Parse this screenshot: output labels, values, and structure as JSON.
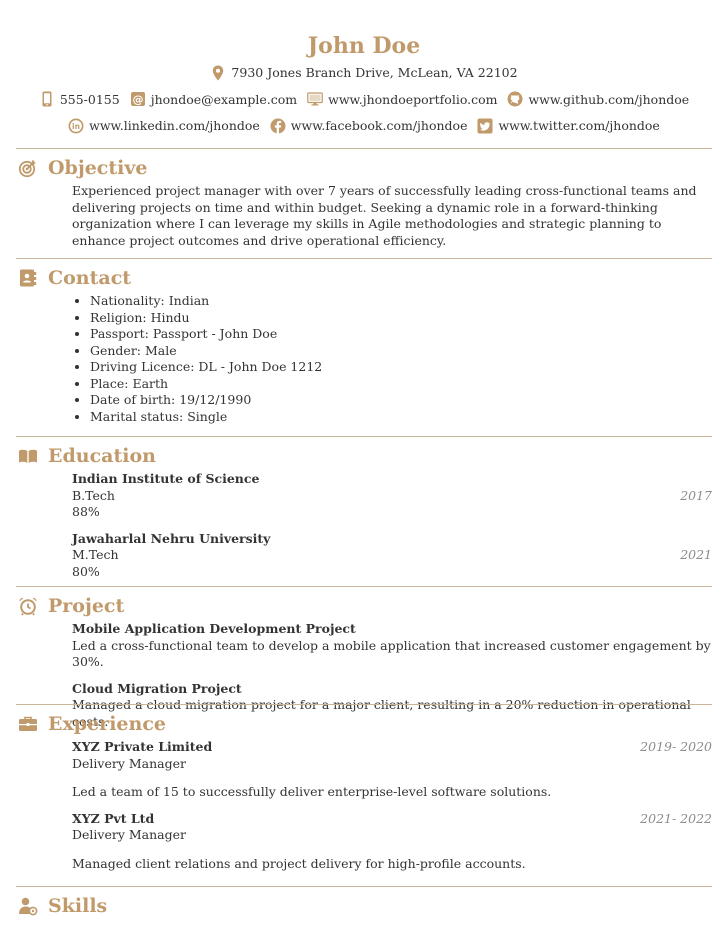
{
  "header": {
    "name": "John Doe",
    "address": "7930 Jones Branch Drive, McLean, VA 22102",
    "phone": "555-0155",
    "email": "jhondoe@example.com",
    "portfolio": "www.jhondoeportfolio.com",
    "github": "www.github.com/jhondoe",
    "linkedin": "www.linkedin.com/jhondoe",
    "facebook": "www.facebook.com/jhondoe",
    "twitter": "www.twitter.com/jhondoe"
  },
  "colors": {
    "accent": "#c19a6b",
    "rule": "#c8b59a",
    "text": "#333333",
    "date": "#8c8c8c"
  },
  "objective": {
    "title": "Objective",
    "icon": "target-icon",
    "text": "Experienced project manager with over 7 years of successfully leading cross-functional teams and delivering projects on time and within budget. Seeking a dynamic role in a forward-thinking organization where I can leverage my skills in Agile methodologies and strategic planning to enhance project outcomes and drive operational efficiency."
  },
  "contact": {
    "title": "Contact",
    "icon": "address-book-icon",
    "items": [
      "Nationality: Indian",
      "Religion: Hindu",
      "Passport: Passport - John Doe",
      "Gender: Male",
      "Driving Licence: DL - John Doe 1212",
      "Place: Earth",
      "Date of birth: 19/12/1990",
      "Marital status: Single"
    ]
  },
  "education": {
    "title": "Education",
    "icon": "book-icon",
    "entries": [
      {
        "school": "Indian Institute of Science",
        "degree": "B.Tech",
        "year": "2017",
        "score": "88%"
      },
      {
        "school": "Jawaharlal Nehru University",
        "degree": "M.Tech",
        "year": "2021",
        "score": "80%"
      }
    ]
  },
  "project": {
    "title": "Project",
    "icon": "alarm-clock-icon",
    "entries": [
      {
        "name": "Mobile Application Development Project",
        "desc": "Led a cross-functional team to develop a mobile application that increased customer engagement by 30%."
      },
      {
        "name": "Cloud Migration Project",
        "desc": "Managed a cloud migration project for a major client, resulting in a 20% reduction in operational costs."
      }
    ]
  },
  "experience": {
    "title": "Experience",
    "icon": "briefcase-icon",
    "entries": [
      {
        "company": "XYZ Private Limited",
        "role": "Delivery Manager",
        "dates": "2019- 2020",
        "desc": "Led a team of 15 to successfully deliver enterprise-level software solutions."
      },
      {
        "company": "XYZ Pvt Ltd",
        "role": "Delivery Manager",
        "dates": "2021- 2022",
        "desc": "Managed client relations and project delivery for high-profile accounts."
      }
    ]
  },
  "skills": {
    "title": "Skills",
    "icon": "user-gear-icon"
  }
}
